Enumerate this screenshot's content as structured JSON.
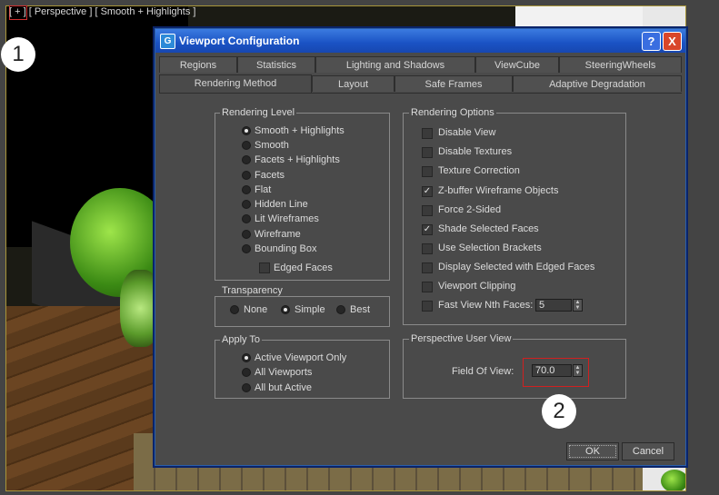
{
  "viewport": {
    "label": "[ + ] [ Perspective ] [ Smooth + Highlights ]",
    "marker1": "1",
    "marker2": "2"
  },
  "dialog": {
    "title": "Viewport Configuration",
    "help_glyph": "?",
    "close_glyph": "X",
    "title_icon_glyph": "G",
    "tabs_row1": [
      "Regions",
      "Statistics",
      "Lighting and Shadows",
      "ViewCube",
      "SteeringWheels"
    ],
    "tabs_row2": [
      "Rendering Method",
      "Layout",
      "Safe Frames",
      "Adaptive Degradation"
    ],
    "active_tab": "Rendering Method",
    "rendering_level": {
      "title": "Rendering Level",
      "options": [
        "Smooth + Highlights",
        "Smooth",
        "Facets + Highlights",
        "Facets",
        "Flat",
        "Hidden Line",
        "Lit Wireframes",
        "Wireframe",
        "Bounding Box"
      ],
      "selected": "Smooth + Highlights",
      "edged_faces": "Edged Faces"
    },
    "transparency": {
      "title": "Transparency",
      "options": [
        "None",
        "Simple",
        "Best"
      ],
      "selected": "Simple"
    },
    "apply_to": {
      "title": "Apply To",
      "options": [
        "Active Viewport Only",
        "All Viewports",
        "All but Active"
      ],
      "selected": "Active Viewport Only"
    },
    "rendering_options": {
      "title": "Rendering Options",
      "items": [
        {
          "label": "Disable View",
          "checked": false
        },
        {
          "label": "Disable Textures",
          "checked": false
        },
        {
          "label": "Texture Correction",
          "checked": false
        },
        {
          "label": "Z-buffer Wireframe Objects",
          "checked": true
        },
        {
          "label": "Force 2-Sided",
          "checked": false
        },
        {
          "label": "Shade Selected Faces",
          "checked": true
        },
        {
          "label": "Use Selection Brackets",
          "checked": false
        },
        {
          "label": "Display Selected with Edged Faces",
          "checked": false
        },
        {
          "label": "Viewport Clipping",
          "checked": false
        },
        {
          "label": "Fast View Nth Faces:",
          "checked": false
        }
      ],
      "nth_faces_value": "5"
    },
    "perspective_user_view": {
      "title": "Perspective User View",
      "fov_label": "Field Of View:",
      "fov_value": "70.0"
    },
    "ok_label": "OK",
    "cancel_label": "Cancel"
  },
  "colors": {
    "titlebar": "#1a52c4",
    "highlight_box": "#d02020",
    "dialog_bg": "#4a4a4a"
  }
}
